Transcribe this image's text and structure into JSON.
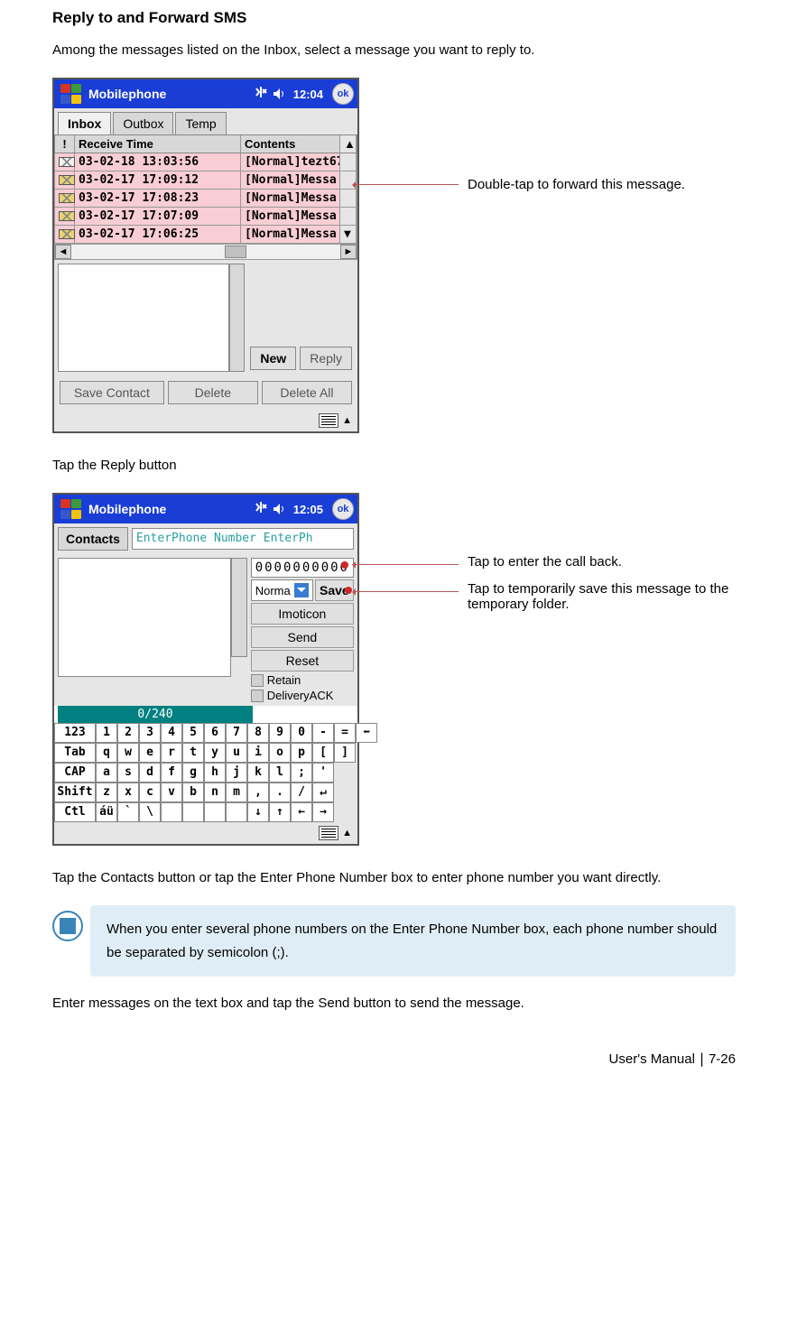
{
  "section_title": "Reply to and Forward SMS",
  "intro_text": "Among the messages listed on the Inbox, select a message you want to reply to.",
  "fig1": {
    "app_title": "Mobilephone",
    "time": "12:04",
    "ok": "ok",
    "tabs": {
      "inbox": "Inbox",
      "outbox": "Outbox",
      "temp": "Temp"
    },
    "headers": {
      "bang": "!",
      "time": "Receive Time",
      "contents": "Contents"
    },
    "rows": [
      {
        "time": "03-02-18 13:03:56",
        "content": "[Normal]tezt67",
        "open": true
      },
      {
        "time": "03-02-17 17:09:12",
        "content": "[Normal]Messa",
        "open": false
      },
      {
        "time": "03-02-17 17:08:23",
        "content": "[Normal]Messa",
        "open": false
      },
      {
        "time": "03-02-17 17:07:09",
        "content": "[Normal]Messa",
        "open": false
      },
      {
        "time": "03-02-17 17:06:25",
        "content": "[Normal]Messa",
        "open": false
      }
    ],
    "buttons": {
      "new": "New",
      "reply": "Reply",
      "save_contact": "Save Contact",
      "delete": "Delete",
      "delete_all": "Delete All"
    },
    "callout": "Double-tap to forward this message."
  },
  "step2": "Tap the Reply button",
  "fig2": {
    "app_title": "Mobilephone",
    "time": "12:05",
    "ok": "ok",
    "contacts_btn": "Contacts",
    "entry_placeholder": "EnterPhone Number EnterPh",
    "phone_value": "0000000000",
    "type_label": "Norma",
    "save_btn": "Save",
    "imoticon_btn": "Imoticon",
    "send_btn": "Send",
    "reset_btn": "Reset",
    "retain_label": "Retain",
    "delivery_label": "DeliveryACK",
    "char_count": "0/240",
    "kb": {
      "r1": [
        "123",
        "1",
        "2",
        "3",
        "4",
        "5",
        "6",
        "7",
        "8",
        "9",
        "0",
        "-",
        "=",
        "⬅"
      ],
      "r2": [
        "Tab",
        "q",
        "w",
        "e",
        "r",
        "t",
        "y",
        "u",
        "i",
        "o",
        "p",
        "[",
        "]"
      ],
      "r3": [
        "CAP",
        "a",
        "s",
        "d",
        "f",
        "g",
        "h",
        "j",
        "k",
        "l",
        ";",
        "'"
      ],
      "r4": [
        "Shift",
        "z",
        "x",
        "c",
        "v",
        "b",
        "n",
        "m",
        ",",
        ".",
        "/",
        "↵"
      ],
      "r5": [
        "Ctl",
        "áü",
        "`",
        "\\",
        " ",
        " ",
        " ",
        " ",
        "↓",
        "↑",
        "←",
        "→"
      ]
    },
    "callout_phone": "Tap to enter the call back.",
    "callout_save": "Tap to temporarily save this message to the temporary folder."
  },
  "step3": "Tap the Contacts button or tap the Enter Phone Number box to enter phone number you want directly.",
  "note_text": "When you enter several phone numbers on the Enter Phone Number box, each phone number should be separated by semicolon (;).",
  "step4": "Enter messages on the text box and tap the Send button to send the message.",
  "footer_prefix": "User's Manual",
  "footer_page": "7-26"
}
